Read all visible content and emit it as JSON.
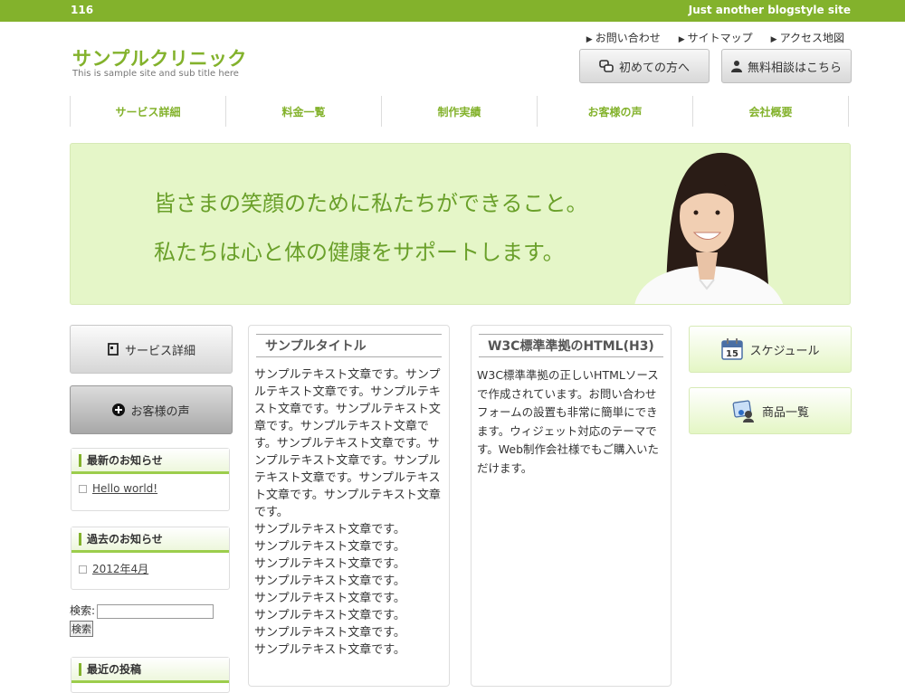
{
  "topbar": {
    "left": "116",
    "right": "Just another blogstyle site"
  },
  "site": {
    "title": "サンプルクリニック",
    "subtitle": "This is sample site and sub title here"
  },
  "toplinks": [
    "お問い合わせ",
    "サイトマップ",
    "アクセス地図"
  ],
  "header_buttons": {
    "first_visit": "初めての方へ",
    "consult": "無料相談はこちら"
  },
  "nav": [
    "サービス詳細",
    "料金一覧",
    "制作実績",
    "お客様の声",
    "会社概要"
  ],
  "hero": {
    "line1": "皆さまの笑顔のために私たちができること。",
    "line2": "私たちは心と体の健康をサポートします。"
  },
  "side_buttons": {
    "service": "サービス詳細",
    "voice": "お客様の声"
  },
  "widgets": {
    "latest": {
      "title": "最新のお知らせ",
      "item": "Hello world!"
    },
    "archive": {
      "title": "過去のお知らせ",
      "item": "2012年4月"
    },
    "recent": {
      "title": "最近の投稿"
    }
  },
  "search": {
    "label": "検索:",
    "button": "検索"
  },
  "column1": {
    "title": "サンプルタイトル",
    "text": "サンプルテキスト文章です。サンプルテキスト文章です。サンプルテキスト文章です。サンプルテキスト文章です。サンプルテキスト文章です。サンプルテキスト文章です。サンプルテキスト文章です。サンプルテキスト文章です。サンプルテキスト文章です。サンプルテキスト文章です。"
  },
  "column1_lines": [
    "サンプルテキスト文章です。",
    "サンプルテキスト文章です。",
    "サンプルテキスト文章です。",
    "サンプルテキスト文章です。",
    "サンプルテキスト文章です。",
    "サンプルテキスト文章です。",
    "サンプルテキスト文章です。",
    "サンプルテキスト文章です。"
  ],
  "column2": {
    "title": "W3C標準準拠のHTML(H3)",
    "text": "W3C標準準拠の正しいHTMLソースで作成されています。お問い合わせフォームの設置も非常に簡単にできます。ウィジェット対応のテーマです。Web制作会社様でもご購入いただけます。"
  },
  "right_buttons": {
    "schedule": "スケジュール",
    "products": "商品一覧"
  },
  "colors": {
    "accent": "#83b22c",
    "hero_bg": "#e5f6c8"
  }
}
